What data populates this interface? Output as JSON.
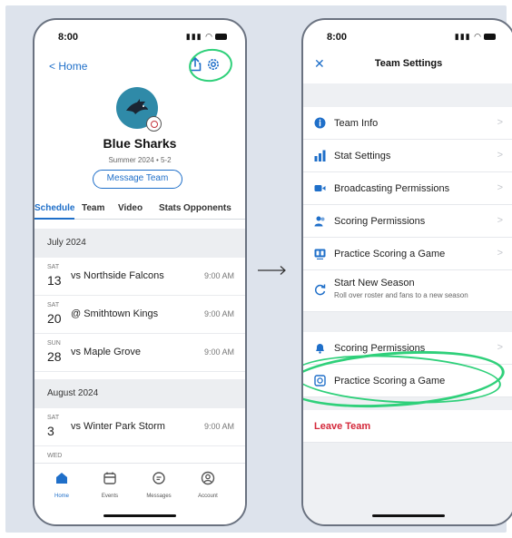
{
  "colors": {
    "accent": "#1f6fc9",
    "highlight": "#2fd07a",
    "danger": "#d4283a",
    "background": "#dde3ec"
  },
  "left_phone": {
    "status": {
      "time": "8:00"
    },
    "back_label": "Home",
    "icons": [
      "share-icon",
      "gear-icon"
    ],
    "team": {
      "name": "Blue Sharks",
      "subtitle": "Summer 2024 • 5-2",
      "message_button": "Message Team"
    },
    "tabs": [
      "Schedule",
      "Team",
      "Video",
      "Stats",
      "Opponents"
    ],
    "sections": [
      {
        "title": "July 2024",
        "events": [
          {
            "dow": "SAT",
            "day": "13",
            "name": "vs Northside Falcons",
            "time": "9:00 AM"
          },
          {
            "dow": "SAT",
            "day": "20",
            "name": "@ Smithtown Kings",
            "time": "9:00 AM"
          },
          {
            "dow": "SUN",
            "day": "28",
            "name": "vs Maple Grove",
            "time": "9:00 AM"
          }
        ]
      },
      {
        "title": "August 2024",
        "events": [
          {
            "dow": "SAT",
            "day": "3",
            "name": "vs Winter Park Storm",
            "time": "9:00 AM"
          },
          {
            "dow": "WED",
            "day": "",
            "name": "",
            "time": ""
          }
        ]
      }
    ],
    "tabbar": [
      "Home",
      "Events",
      "Messages",
      "Account"
    ]
  },
  "right_phone": {
    "status": {
      "time": "8:00"
    },
    "title": "Team Settings",
    "group1": [
      {
        "icon": "info-icon",
        "label": "Team Info"
      },
      {
        "icon": "stats-bars-icon",
        "label": "Stat Settings"
      },
      {
        "icon": "video-camera-icon",
        "label": "Broadcasting Permissions"
      },
      {
        "icon": "people-icon",
        "label": "Scoring Permissions"
      },
      {
        "icon": "scoreboard-icon",
        "label": "Practice Scoring a Game"
      },
      {
        "icon": "refresh-icon",
        "label": "Start New Season",
        "sublabel": "Roll over roster and fans to a new season"
      }
    ],
    "group2": [
      {
        "icon": "bell-icon",
        "label": "Scoring Permissions"
      },
      {
        "icon": "practice-scoring-icon",
        "label": "Practice Scoring a Game"
      }
    ],
    "leave_label": "Leave Team"
  }
}
